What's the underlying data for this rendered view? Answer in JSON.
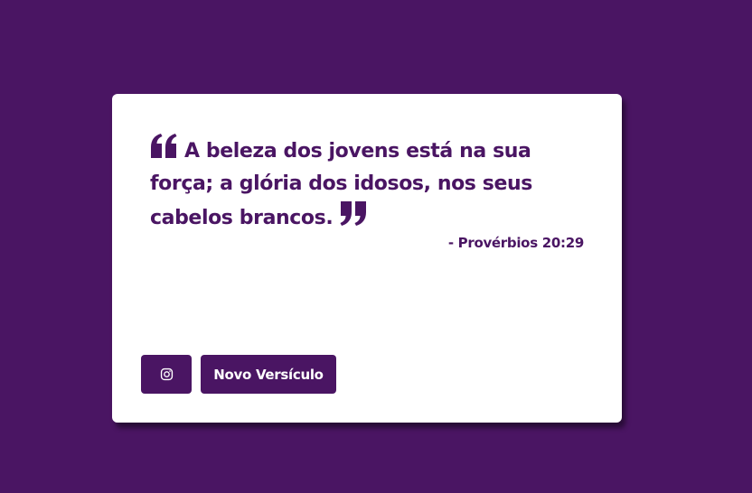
{
  "quote": {
    "text": "A beleza dos jovens está na sua força; a glória dos idosos, nos seus cabelos brancos.",
    "author": "- Provérbios 20:29"
  },
  "buttons": {
    "instagram_icon": "instagram-icon",
    "new_verse_label": "Novo Versículo"
  },
  "colors": {
    "background": "#4a1563",
    "card": "#ffffff",
    "accent": "#4a1563"
  }
}
